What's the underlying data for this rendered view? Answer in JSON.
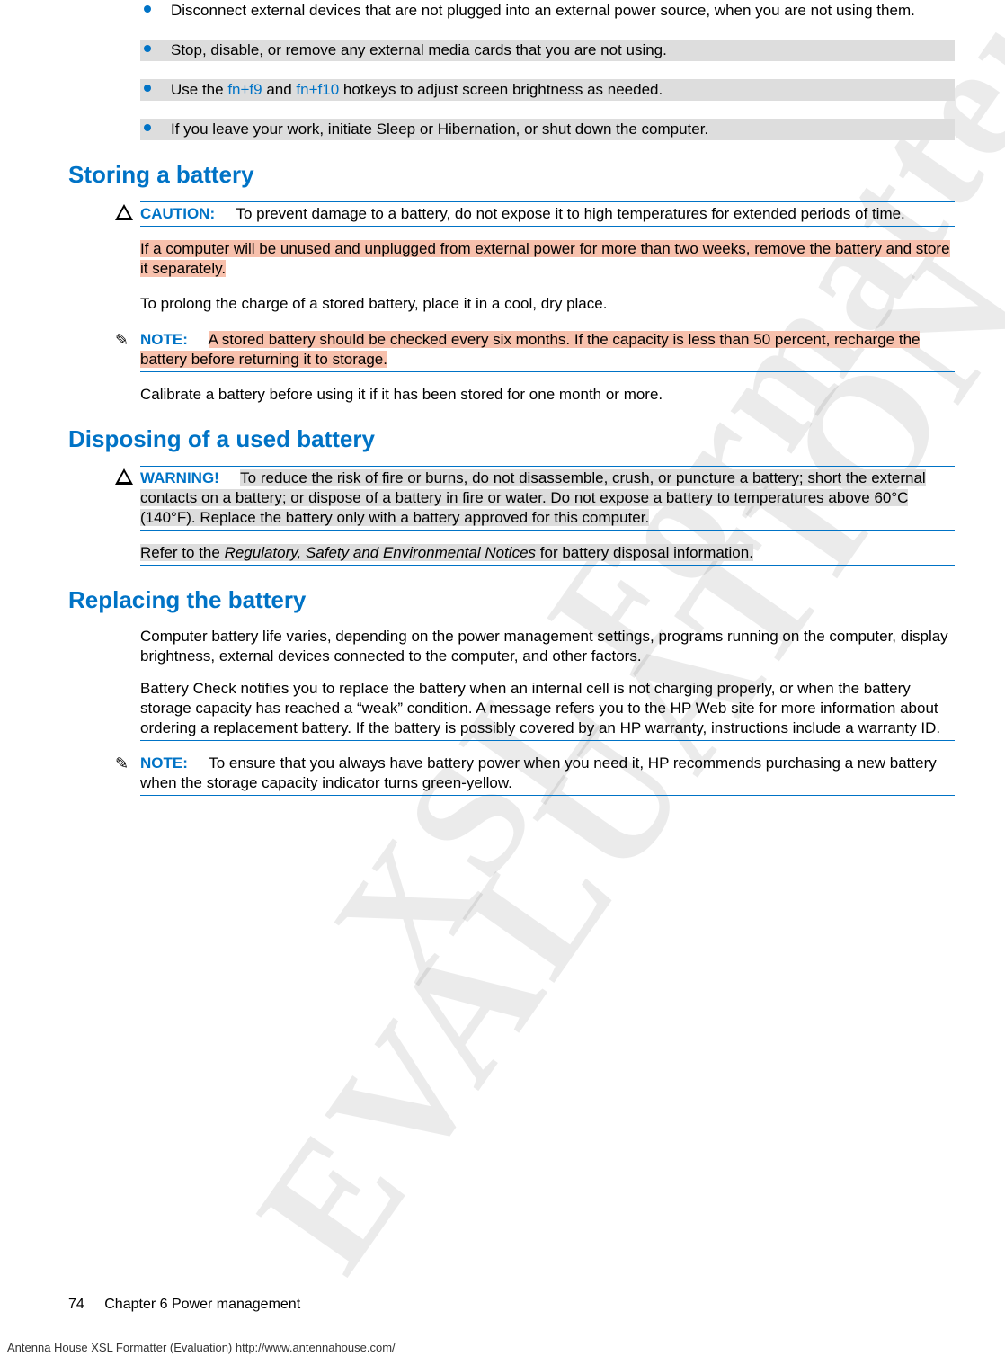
{
  "watermarks": {
    "w1": "XSL Formatter",
    "w2": "EVALUATION"
  },
  "bullets": [
    {
      "pre": "Disconnect external devices that are not plugged into an external power source, when you are not using them.",
      "shaded": false
    },
    {
      "pre": "Stop, disable, or remove any external media cards that you are not using.",
      "shaded": true
    },
    {
      "pre": "Use the ",
      "link1": "fn+f9",
      "mid": " and ",
      "link2": "fn+f10",
      "post": " hotkeys to adjust screen brightness as needed.",
      "shaded": true,
      "has_links": true
    },
    {
      "pre": "If you leave your work, initiate Sleep or Hibernation, or shut down the computer.",
      "shaded": true
    }
  ],
  "sections": {
    "storing": {
      "title": "Storing a battery",
      "caution_label": "CAUTION:",
      "caution_text": "To prevent damage to a battery, do not expose it to high temperatures for extended periods of time.",
      "p1": "If a computer will be unused and unplugged from external power for more than two weeks, remove the battery and store it separately.",
      "p2": "To prolong the charge of a stored battery, place it in a cool, dry place.",
      "note_label": "NOTE:",
      "note_text": "A stored battery should be checked every six months. If the capacity is less than 50 percent, recharge the battery before returning it to storage.",
      "p3": "Calibrate a battery before using it if it has been stored for one month or more."
    },
    "disposing": {
      "title": "Disposing of a used battery",
      "warn_label": "WARNING!",
      "warn_text": "To reduce the risk of fire or burns, do not disassemble, crush, or puncture a battery; short the external contacts on a battery; or dispose of a battery in fire or water. Do not expose a battery to temperatures above 60°C (140°F). Replace the battery only with a battery approved for this computer.",
      "p1_pre": "Refer to the ",
      "p1_em": "Regulatory, Safety and Environmental Notices",
      "p1_post": " for battery disposal information."
    },
    "replacing": {
      "title": "Replacing the battery",
      "p1": "Computer battery life varies, depending on the power management settings, programs running on the computer, display brightness, external devices connected to the computer, and other factors.",
      "p2": "Battery Check notifies you to replace the battery when an internal cell is not charging properly, or when the battery storage capacity has reached a “weak” condition. A message refers you to the HP Web site for more information about ordering a replacement battery. If the battery is possibly covered by an HP warranty, instructions include a warranty ID.",
      "note_label": "NOTE:",
      "note_text": "To ensure that you always have battery power when you need it, HP recommends purchasing a new battery when the storage capacity indicator turns green-yellow."
    }
  },
  "footer": {
    "page_num": "74",
    "chapter_label": "Chapter 6   Power management",
    "eval": "Antenna House XSL Formatter (Evaluation)  http://www.antennahouse.com/"
  }
}
